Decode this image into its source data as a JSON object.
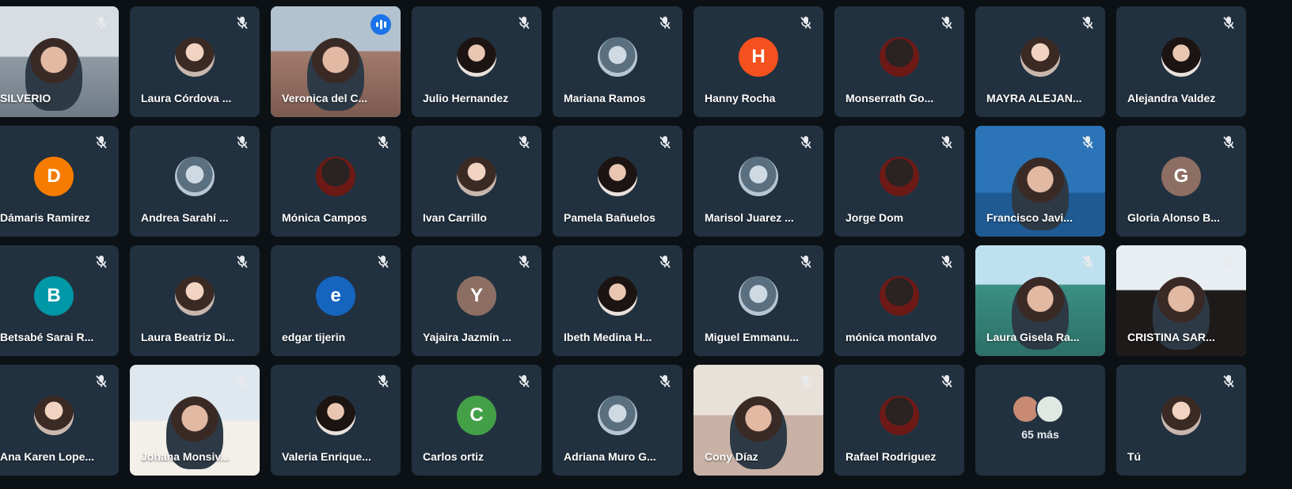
{
  "colors": {
    "tile_bg": "#22313f",
    "page_bg": "#0c1116",
    "active_border": "#8ab4f8",
    "speaking_badge": "#1a73e8"
  },
  "icons": {
    "muted": "mic-off-icon",
    "speaking": "audio-wave-icon"
  },
  "participants": [
    {
      "name": "SILVERIO",
      "tile": "video"
    },
    {
      "name": "Laura Córdova ...",
      "tile": "photo"
    },
    {
      "name": "Veronica del C...",
      "tile": "video",
      "active": true
    },
    {
      "name": "Julio Hernandez",
      "tile": "photo"
    },
    {
      "name": "Mariana Ramos",
      "tile": "photo"
    },
    {
      "name": "Hanny Rocha",
      "tile": "initial",
      "initial": "H",
      "color": "#f4511e"
    },
    {
      "name": "Monserrath Go...",
      "tile": "photo"
    },
    {
      "name": "MAYRA ALEJAN...",
      "tile": "photo"
    },
    {
      "name": "Alejandra Valdez",
      "tile": "photo"
    },
    {
      "name": "Dámaris Ramirez",
      "tile": "initial",
      "initial": "D",
      "color": "#f57c00"
    },
    {
      "name": "Andrea Sarahí ...",
      "tile": "photo"
    },
    {
      "name": "Mónica Campos",
      "tile": "photo"
    },
    {
      "name": "Ivan Carrillo",
      "tile": "photo"
    },
    {
      "name": "Pamela Bañuelos",
      "tile": "photo"
    },
    {
      "name": "Marisol Juarez ...",
      "tile": "photo"
    },
    {
      "name": "Jorge Dom",
      "tile": "photo"
    },
    {
      "name": "Francisco Javi...",
      "tile": "video"
    },
    {
      "name": "Gloria Alonso B...",
      "tile": "initial",
      "initial": "G",
      "color": "#8d6e63"
    },
    {
      "name": "Betsabé Sarai R...",
      "tile": "initial",
      "initial": "B",
      "color": "#0097a7"
    },
    {
      "name": "Laura Beatriz Di...",
      "tile": "photo"
    },
    {
      "name": "edgar tijerin",
      "tile": "initial",
      "initial": "e",
      "color": "#1565c0"
    },
    {
      "name": "Yajaira Jazmín ...",
      "tile": "initial",
      "initial": "Y",
      "color": "#8d6e63"
    },
    {
      "name": "Ibeth Medina H...",
      "tile": "photo"
    },
    {
      "name": "Miguel Emmanu...",
      "tile": "photo"
    },
    {
      "name": "mónica montalvo",
      "tile": "photo"
    },
    {
      "name": "Laura Gisela Ra...",
      "tile": "video"
    },
    {
      "name": "CRISTINA SAR...",
      "tile": "video"
    },
    {
      "name": "Ana Karen Lope...",
      "tile": "photo"
    },
    {
      "name": "Johana Monsiv...",
      "tile": "video"
    },
    {
      "name": "Valeria Enrique...",
      "tile": "photo"
    },
    {
      "name": "Carlos ortiz",
      "tile": "initial",
      "initial": "C",
      "color": "#43a047"
    },
    {
      "name": "Adriana Muro G...",
      "tile": "photo"
    },
    {
      "name": "Cony Díaz",
      "tile": "video"
    },
    {
      "name": "Rafael Rodriguez",
      "tile": "photo"
    },
    {
      "name": "",
      "tile": "more",
      "label": "65 más"
    },
    {
      "name": "Tú",
      "tile": "photo"
    }
  ]
}
